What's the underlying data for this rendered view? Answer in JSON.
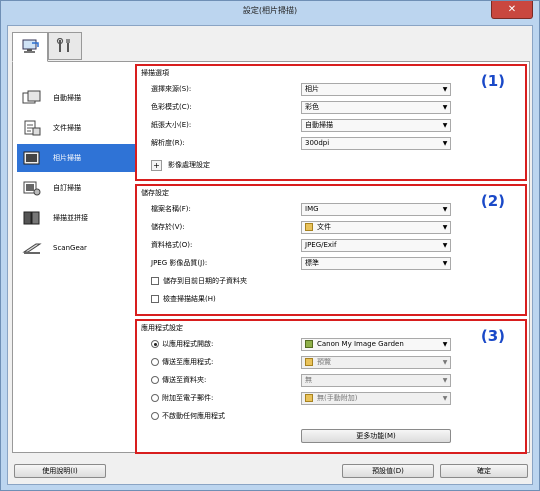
{
  "window": {
    "title": "設定(相片掃描)",
    "close_label": "✕"
  },
  "sidebar": {
    "items": [
      {
        "label": "自動掃描"
      },
      {
        "label": "文件掃描"
      },
      {
        "label": "相片掃描"
      },
      {
        "label": "自訂掃描"
      },
      {
        "label": "掃描並拼接"
      },
      {
        "label": "ScanGear"
      }
    ]
  },
  "section1": {
    "title": "掃描選項",
    "number": "(1)",
    "rows": [
      {
        "label": "選擇來源(S):",
        "value": "相片"
      },
      {
        "label": "色彩模式(C):",
        "value": "彩色"
      },
      {
        "label": "紙張大小(E):",
        "value": "自動掃描"
      },
      {
        "label": "解析度(R):",
        "value": "300dpi"
      }
    ],
    "expand_label": "影像處理設定"
  },
  "section2": {
    "title": "儲存設定",
    "number": "(2)",
    "rows": [
      {
        "label": "檔案名稱(F):",
        "value": "IMG"
      },
      {
        "label": "儲存於(V):",
        "value": "文件"
      },
      {
        "label": "資料格式(O):",
        "value": "JPEG/Exif"
      },
      {
        "label": "JPEG 影像品質(J):",
        "value": "標準"
      }
    ],
    "checks": [
      {
        "label": "儲存到目前日期的子資料夾"
      },
      {
        "label": "檢查掃描結果(H)"
      }
    ]
  },
  "section3": {
    "title": "應用程式設定",
    "number": "(3)",
    "rows": [
      {
        "label": "以應用程式開啟:",
        "value": "Canon My Image Garden",
        "selected": true
      },
      {
        "label": "傳送至應用程式:",
        "value": "預覽",
        "selected": false
      },
      {
        "label": "傳送至資料夾:",
        "value": "無",
        "selected": false
      },
      {
        "label": "附加至電子郵件:",
        "value": "無(手動附加)",
        "selected": false
      },
      {
        "label": "不啟動任何應用程式",
        "selected": false
      }
    ],
    "more_label": "更多功能(M)"
  },
  "footer": {
    "help_label": "使用說明(I)",
    "defaults_label": "預設值(D)",
    "ok_label": "確定"
  }
}
